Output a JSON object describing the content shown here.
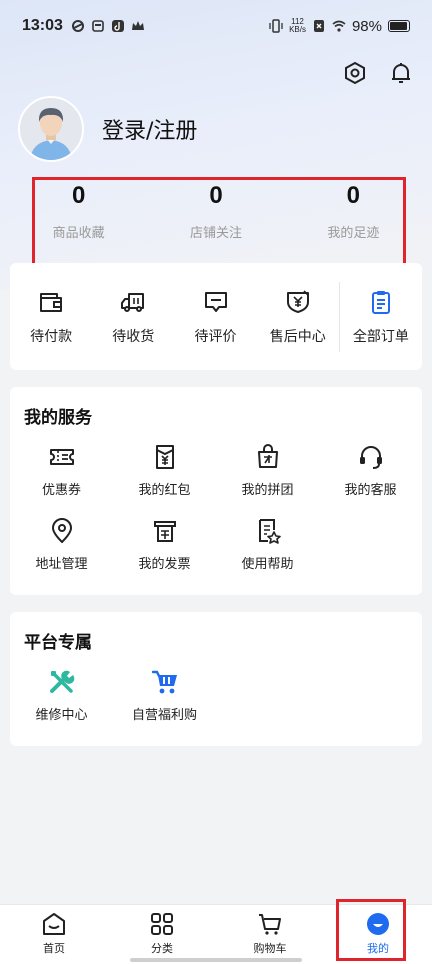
{
  "status_bar": {
    "time": "13:03",
    "net_speed_value": "112",
    "net_speed_unit": "KB/s",
    "battery": "98%"
  },
  "profile": {
    "login_label": "登录/注册"
  },
  "stats": [
    {
      "value": "0",
      "label": "商品收藏"
    },
    {
      "value": "0",
      "label": "店铺关注"
    },
    {
      "value": "0",
      "label": "我的足迹"
    }
  ],
  "orders": [
    {
      "label": "待付款",
      "icon": "wallet-icon"
    },
    {
      "label": "待收货",
      "icon": "truck-icon"
    },
    {
      "label": "待评价",
      "icon": "comment-icon"
    },
    {
      "label": "售后中心",
      "icon": "after-sales-icon"
    },
    {
      "label": "全部订单",
      "icon": "clipboard-icon"
    }
  ],
  "services": {
    "title": "我的服务",
    "items": [
      {
        "label": "优惠券",
        "icon": "coupon-icon"
      },
      {
        "label": "我的红包",
        "icon": "red-envelope-icon"
      },
      {
        "label": "我的拼团",
        "icon": "group-buy-icon"
      },
      {
        "label": "我的客服",
        "icon": "headset-icon"
      },
      {
        "label": "地址管理",
        "icon": "location-icon"
      },
      {
        "label": "我的发票",
        "icon": "invoice-icon"
      },
      {
        "label": "使用帮助",
        "icon": "help-doc-icon"
      }
    ]
  },
  "platform": {
    "title": "平台专属",
    "items": [
      {
        "label": "维修中心",
        "icon": "repair-tools-icon"
      },
      {
        "label": "自营福利购",
        "icon": "shopping-cart-icon"
      }
    ]
  },
  "tabbar": [
    {
      "label": "首页",
      "icon": "home-icon"
    },
    {
      "label": "分类",
      "icon": "category-icon"
    },
    {
      "label": "购物车",
      "icon": "cart-icon"
    },
    {
      "label": "我的",
      "icon": "me-icon",
      "active": true
    }
  ],
  "colors": {
    "accent": "#1e6bf0",
    "highlight": "#e0242b",
    "repair_icon": "#2fb8a0"
  }
}
